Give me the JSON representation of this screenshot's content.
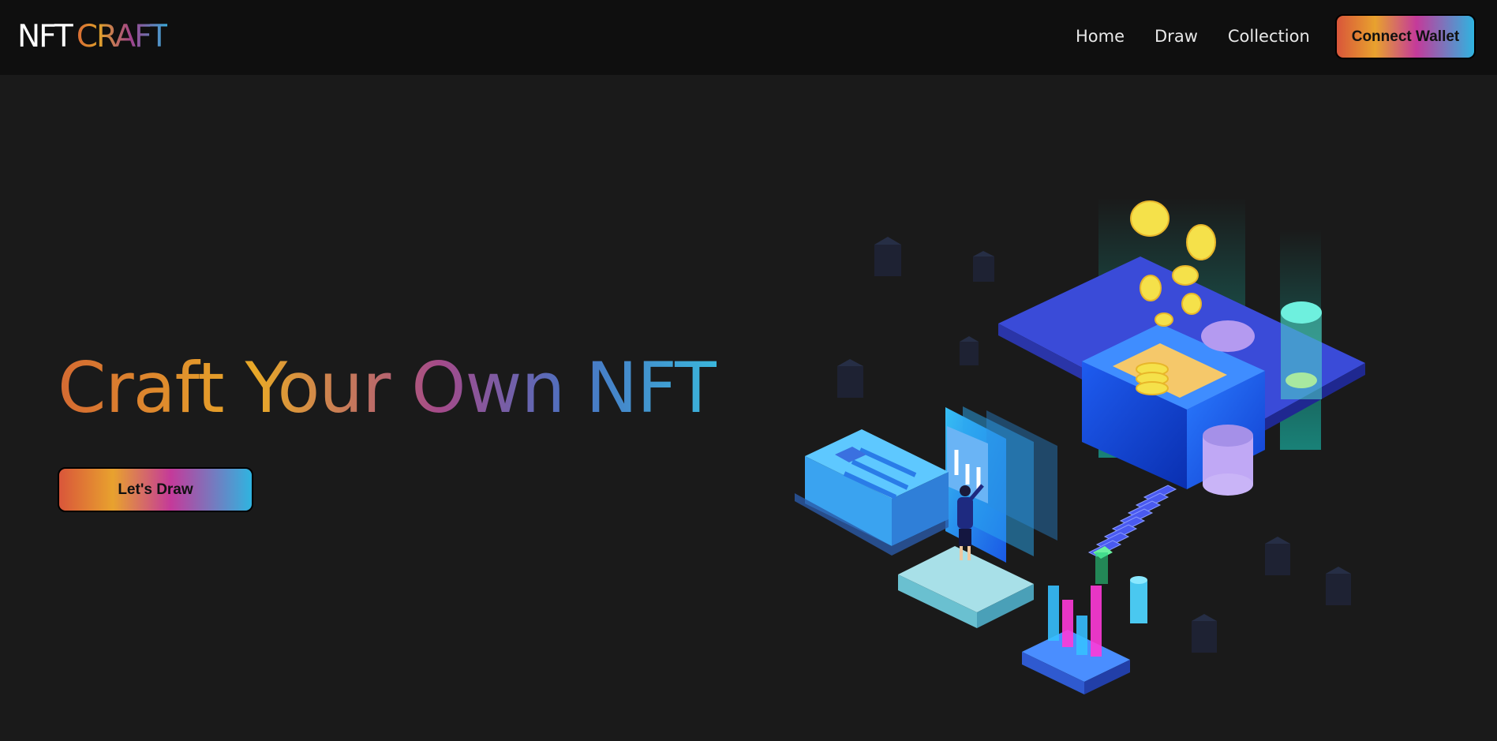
{
  "nav": {
    "logo_part1": "NFT",
    "logo_part2": "CRAFT",
    "links": [
      "Home",
      "Draw",
      "Collection"
    ],
    "connect_label": "Connect Wallet"
  },
  "hero": {
    "title": "Craft Your Own NFT",
    "cta_label": "Let's Draw"
  },
  "illustration": {
    "icon": "isometric-nft-platform-illustration"
  },
  "colors": {
    "background": "#1a1a1a",
    "navbar": "#0f0f0f",
    "gradient": [
      "#d9563a",
      "#e8a22e",
      "#c43a9a",
      "#2fb4e0"
    ]
  }
}
